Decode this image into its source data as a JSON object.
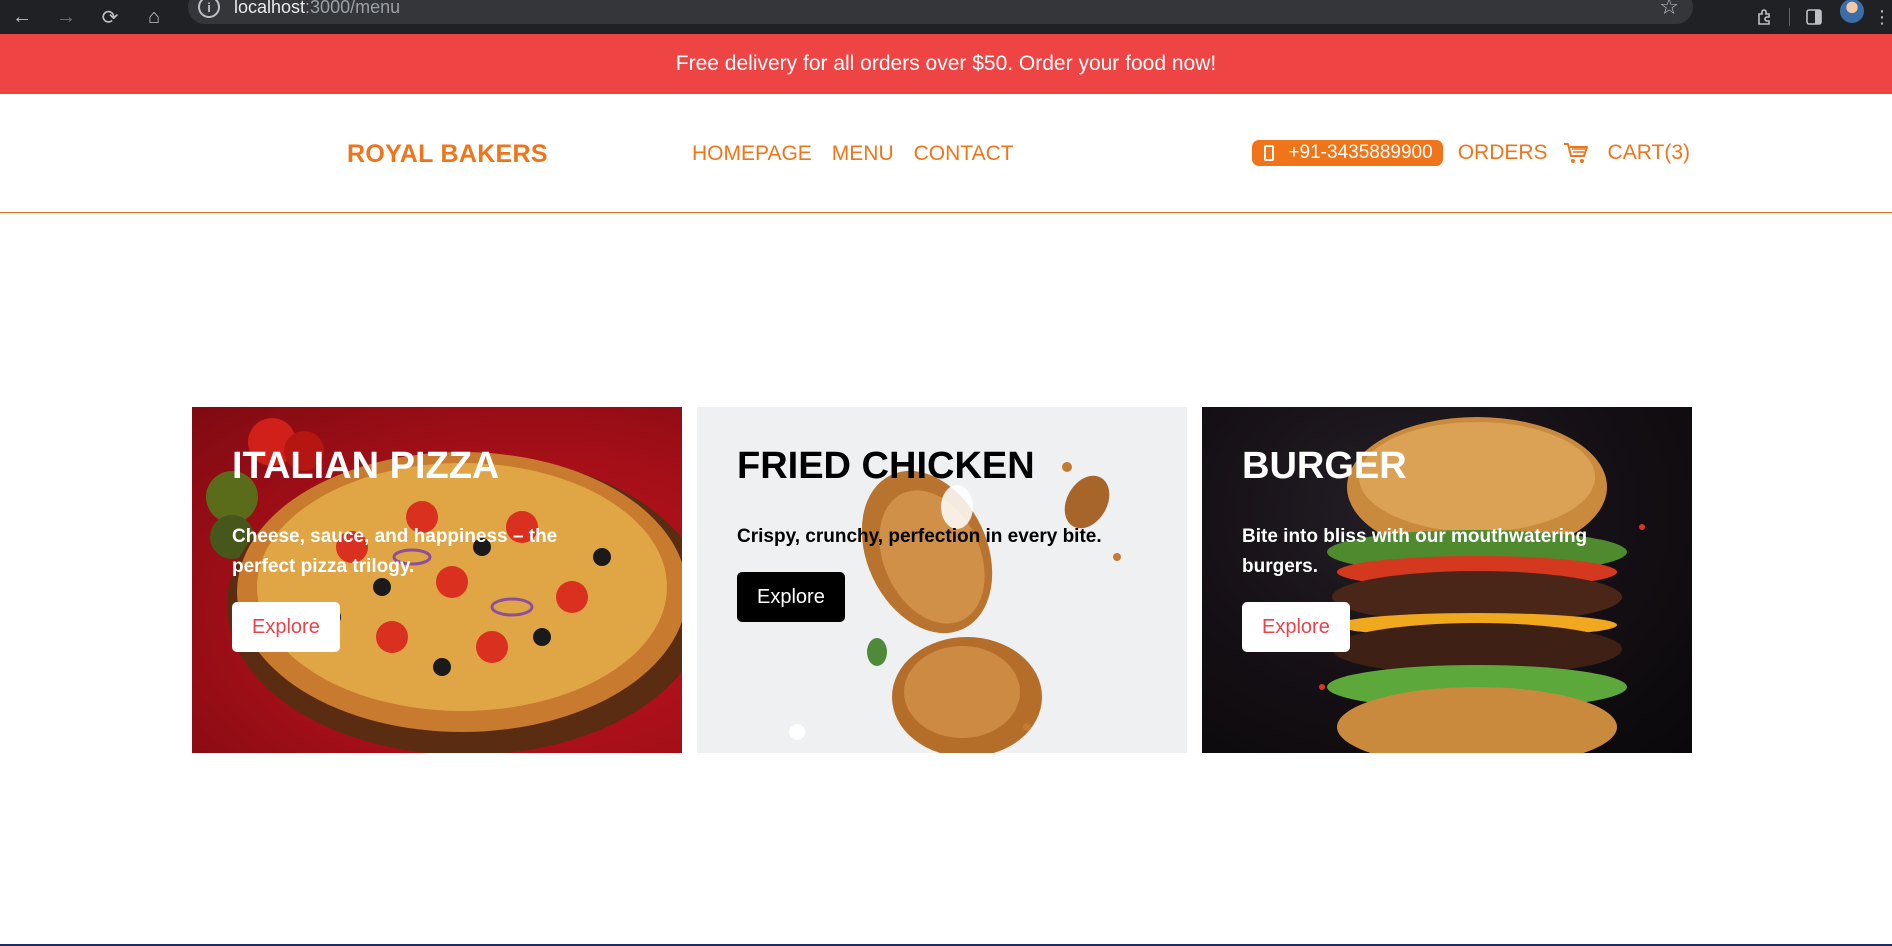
{
  "browser": {
    "url_host": "localhost",
    "url_path": ":3000/menu"
  },
  "promo": {
    "text": "Free delivery for all orders over $50. Order your food now!"
  },
  "header": {
    "brand": "ROYAL BAKERS",
    "nav": [
      "HOMEPAGE",
      "MENU",
      "CONTACT"
    ],
    "phone": "+91-3435889900",
    "orders_label": "ORDERS",
    "cart_label": "CART(3)"
  },
  "cards": [
    {
      "title": "ITALIAN PIZZA",
      "description": "Cheese, sauce, and happiness – the perfect pizza trilogy.",
      "button": "Explore"
    },
    {
      "title": "FRIED CHICKEN",
      "description": "Crispy, crunchy, perfection in every bite.",
      "button": "Explore"
    },
    {
      "title": "BURGER",
      "description": "Bite into bliss with our mouthwatering burgers.",
      "button": "Explore"
    }
  ],
  "colors": {
    "brand_orange": "#f07419",
    "promo_red": "#ef4444",
    "explore_text_red": "#e8434a"
  },
  "icons": {
    "back": "arrow-left-icon",
    "forward": "arrow-right-icon",
    "reload": "reload-icon",
    "home": "home-icon",
    "site_info": "info-icon",
    "bookmark": "star-icon",
    "extensions": "puzzle-icon",
    "side_panel": "side-panel-icon",
    "phone": "phone-icon",
    "cart": "cart-icon"
  }
}
